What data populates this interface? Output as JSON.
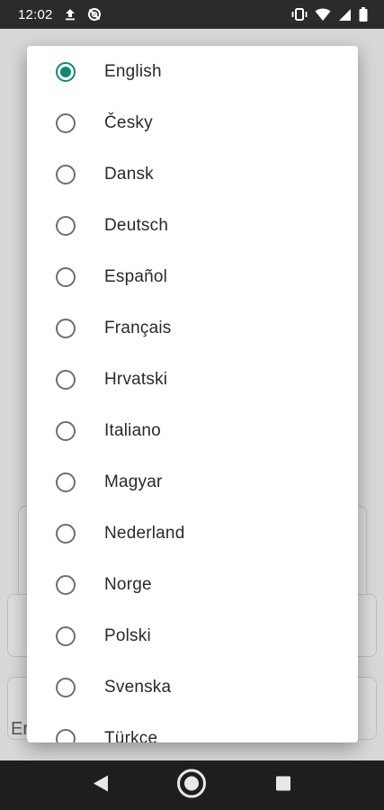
{
  "status_bar": {
    "time": "12:02",
    "icons": [
      "upload-icon",
      "no-sync-icon",
      "vibrate-icon",
      "wifi-icon",
      "signal-icon",
      "battery-icon"
    ]
  },
  "background": {
    "partial_text": "Er"
  },
  "dialog": {
    "selected": "English",
    "accent_color": "#0f8a72",
    "languages": [
      {
        "label": "English",
        "checked": true
      },
      {
        "label": "Česky",
        "checked": false
      },
      {
        "label": "Dansk",
        "checked": false
      },
      {
        "label": "Deutsch",
        "checked": false
      },
      {
        "label": "Español",
        "checked": false
      },
      {
        "label": "Français",
        "checked": false
      },
      {
        "label": "Hrvatski",
        "checked": false
      },
      {
        "label": "Italiano",
        "checked": false
      },
      {
        "label": "Magyar",
        "checked": false
      },
      {
        "label": "Nederland",
        "checked": false
      },
      {
        "label": "Norge",
        "checked": false
      },
      {
        "label": "Polski",
        "checked": false
      },
      {
        "label": "Svenska",
        "checked": false
      },
      {
        "label": "Türkçe",
        "checked": false
      }
    ]
  },
  "nav_bar": {
    "buttons": [
      "back-icon",
      "home-icon",
      "recents-icon"
    ]
  }
}
